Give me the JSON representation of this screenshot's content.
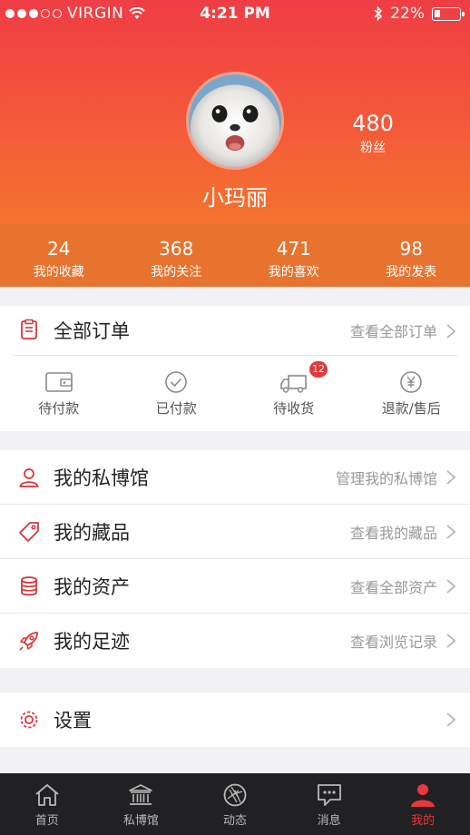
{
  "status_bar": {
    "carrier": "VIRGIN",
    "time": "4:21 PM",
    "battery": "22%",
    "battery_level": 0.22
  },
  "profile": {
    "username": "小玛丽",
    "fans_count": "480",
    "fans_label": "粉丝"
  },
  "stats": [
    {
      "value": "24",
      "label": "我的收藏"
    },
    {
      "value": "368",
      "label": "我的关注"
    },
    {
      "value": "471",
      "label": "我的喜欢"
    },
    {
      "value": "98",
      "label": "我的发表"
    }
  ],
  "orders": {
    "title": "全部订单",
    "hint": "查看全部订单",
    "items": [
      {
        "label": "待付款",
        "icon": "wallet-icon"
      },
      {
        "label": "已付款",
        "icon": "check-circle-icon"
      },
      {
        "label": "待收货",
        "icon": "truck-icon",
        "badge": "12"
      },
      {
        "label": "退款/售后",
        "icon": "yen-circle-icon"
      }
    ]
  },
  "menu": [
    {
      "title": "我的私博馆",
      "hint": "管理我的私博馆",
      "icon": "person-icon"
    },
    {
      "title": "我的藏品",
      "hint": "查看我的藏品",
      "icon": "tag-icon"
    },
    {
      "title": "我的资产",
      "hint": "查看全部资产",
      "icon": "database-icon"
    },
    {
      "title": "我的足迹",
      "hint": "查看浏览记录",
      "icon": "rocket-icon"
    }
  ],
  "settings": {
    "title": "设置",
    "icon": "gear-icon"
  },
  "tabbar": [
    {
      "label": "首页",
      "icon": "home-icon"
    },
    {
      "label": "私博馆",
      "icon": "museum-icon"
    },
    {
      "label": "动态",
      "icon": "aperture-icon"
    },
    {
      "label": "消息",
      "icon": "message-icon"
    },
    {
      "label": "我的",
      "icon": "user-icon",
      "active": true
    }
  ],
  "colors": {
    "accent": "#e8383b",
    "header_top": "#ef3d45",
    "header_bottom": "#f3742e",
    "stats_bar": "#e8732f",
    "tabbar_bg": "#212124"
  }
}
